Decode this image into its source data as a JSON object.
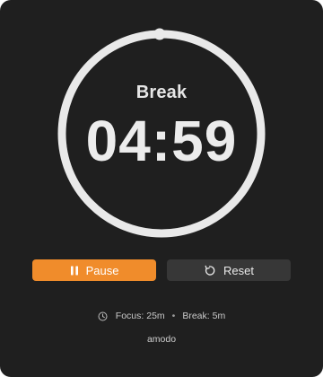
{
  "timer": {
    "mode": "Break",
    "time": "04:59",
    "progress_fraction": 0.997,
    "accent_color": "#f08c2b"
  },
  "controls": {
    "pause_label": "Pause",
    "pause_icon": "pause-icon",
    "reset_label": "Reset",
    "reset_icon": "reset-icon"
  },
  "settings": {
    "clock_icon": "clock-icon",
    "focus_text": "Focus: 25m",
    "separator": "•",
    "break_text": "Break: 5m"
  },
  "footer": {
    "brand": "amodo"
  }
}
